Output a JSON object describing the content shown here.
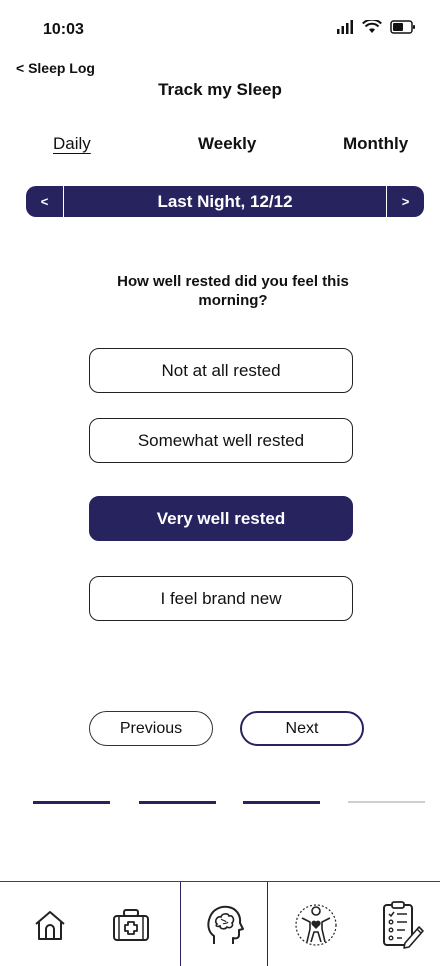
{
  "status": {
    "time": "10:03"
  },
  "header": {
    "back_label": "< Sleep Log",
    "title": "Track my Sleep"
  },
  "tabs": [
    {
      "label": "Daily",
      "active": true
    },
    {
      "label": "Weekly",
      "active": false
    },
    {
      "label": "Monthly",
      "active": false
    }
  ],
  "date_nav": {
    "prev_label": "<",
    "label": "Last Night, 12/12",
    "next_label": ">"
  },
  "question": "How well rested did you feel this morning?",
  "options": [
    {
      "label": "Not at all rested",
      "selected": false
    },
    {
      "label": "Somewhat well rested",
      "selected": false
    },
    {
      "label": "Very well rested",
      "selected": true
    },
    {
      "label": "I feel brand new",
      "selected": false
    }
  ],
  "buttons": {
    "previous": "Previous",
    "next": "Next"
  },
  "progress": {
    "completed": 3,
    "total": 4
  },
  "colors": {
    "accent": "#26235f",
    "inactive": "#cfcfcf"
  },
  "bottom_nav": [
    {
      "icon": "home-icon",
      "active": false
    },
    {
      "icon": "first-aid-kit-icon",
      "active": false
    },
    {
      "icon": "brain-head-icon",
      "active": true
    },
    {
      "icon": "body-heart-icon",
      "active": false
    },
    {
      "icon": "checklist-icon",
      "active": false
    }
  ]
}
